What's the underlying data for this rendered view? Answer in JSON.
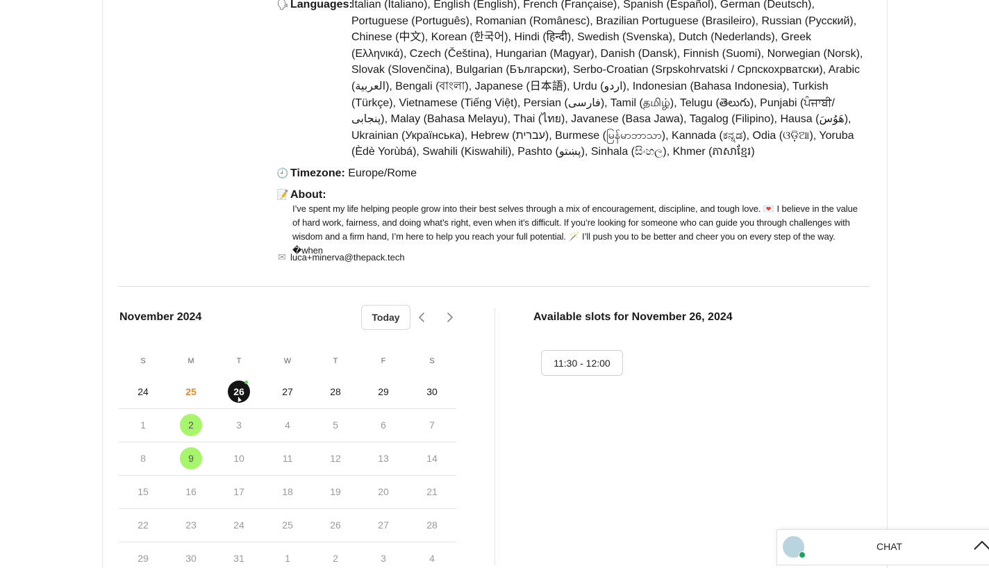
{
  "profile": {
    "languages_label": "Languages:",
    "languages_value": "Italian (Italiano), English (English), French (Française), Spanish (Español), German (Deutsch), Portuguese (Português), Romanian (Românesc), Brazilian Portuguese (Brasileiro), Russian (Русский), Chinese (中文), Korean (한국어), Hindi (हिन्दी), Swedish (Svenska), Dutch (Nederlands), Greek (Ελληνικά), Czech (Čeština), Hungarian (Magyar), Danish (Dansk), Finnish (Suomi), Norwegian (Norsk), Slovak (Slovenčina), Bulgarian (Български), Serbo-Croatian (Srpskohrvatski / Српскохрватски), Arabic (العربية), Bengali (বাংলা), Japanese (日本語), Urdu (اردو), Indonesian (Bahasa Indonesia), Turkish (Türkçe), Vietnamese (Tiếng Việt), Persian (فارسی), Tamil (தமிழ்), Telugu (తెలుగు), Punjabi (ਪੰਜਾਬੀ/پنجابی), Malay (Bahasa Melayu), Thai (ไทย), Javanese (Basa Jawa), Tagalog (Filipino), Hausa (هَوُسَ), Ukrainian (Українська), Hebrew (עברית), Burmese (မြန်မာဘာသာ), Kannada (ಕನ್ನಡ), Odia (ଓଡ଼ିଆ), Yoruba (Èdè Yorùbá), Swahili (Kiswahili), Pashto (پښتو), Sinhala (සිංහල), Khmer (ភាសាខ្មែរ)",
    "timezone_label": "Timezone:",
    "timezone_value": "Europe/Rome",
    "about_label": "About:",
    "about_text": "I’ve spent my life helping people grow into their best selves through a mix of encouragement, discipline, and tough love. 💌 I believe in the value of hard work, fairness, and doing what’s right, even when it’s difficult. If you’re looking for someone who can guide you through challenges with wisdom and a firm hand, I’m here to help you reach your full potential. 🪄 I’ll push you to be better and cheer you on every step of the way. �when",
    "email": "luca+minerva@thepack.tech",
    "icons": {
      "languages": "🗣",
      "timezone": "🕘",
      "about": "📝",
      "email": "✉"
    }
  },
  "calendar": {
    "month_title": "November 2024",
    "today_label": "Today",
    "weekdays": [
      "S",
      "M",
      "T",
      "W",
      "T",
      "F",
      "S"
    ],
    "weeks": [
      [
        "24",
        "25",
        "26",
        "27",
        "28",
        "29",
        "30"
      ],
      [
        "1",
        "2",
        "3",
        "4",
        "5",
        "6",
        "7"
      ],
      [
        "8",
        "9",
        "10",
        "11",
        "12",
        "13",
        "14"
      ],
      [
        "15",
        "16",
        "17",
        "18",
        "19",
        "20",
        "21"
      ],
      [
        "22",
        "23",
        "24",
        "25",
        "26",
        "27",
        "28"
      ],
      [
        "29",
        "30",
        "31",
        "1",
        "2",
        "3",
        "4"
      ]
    ],
    "today_date": "25",
    "selected_date": "26",
    "available_dates": [
      "2",
      "9"
    ]
  },
  "slots": {
    "title": "Available slots for November 26, 2024",
    "items": [
      "11:30 - 12:00"
    ]
  },
  "chat": {
    "label": "CHAT"
  }
}
